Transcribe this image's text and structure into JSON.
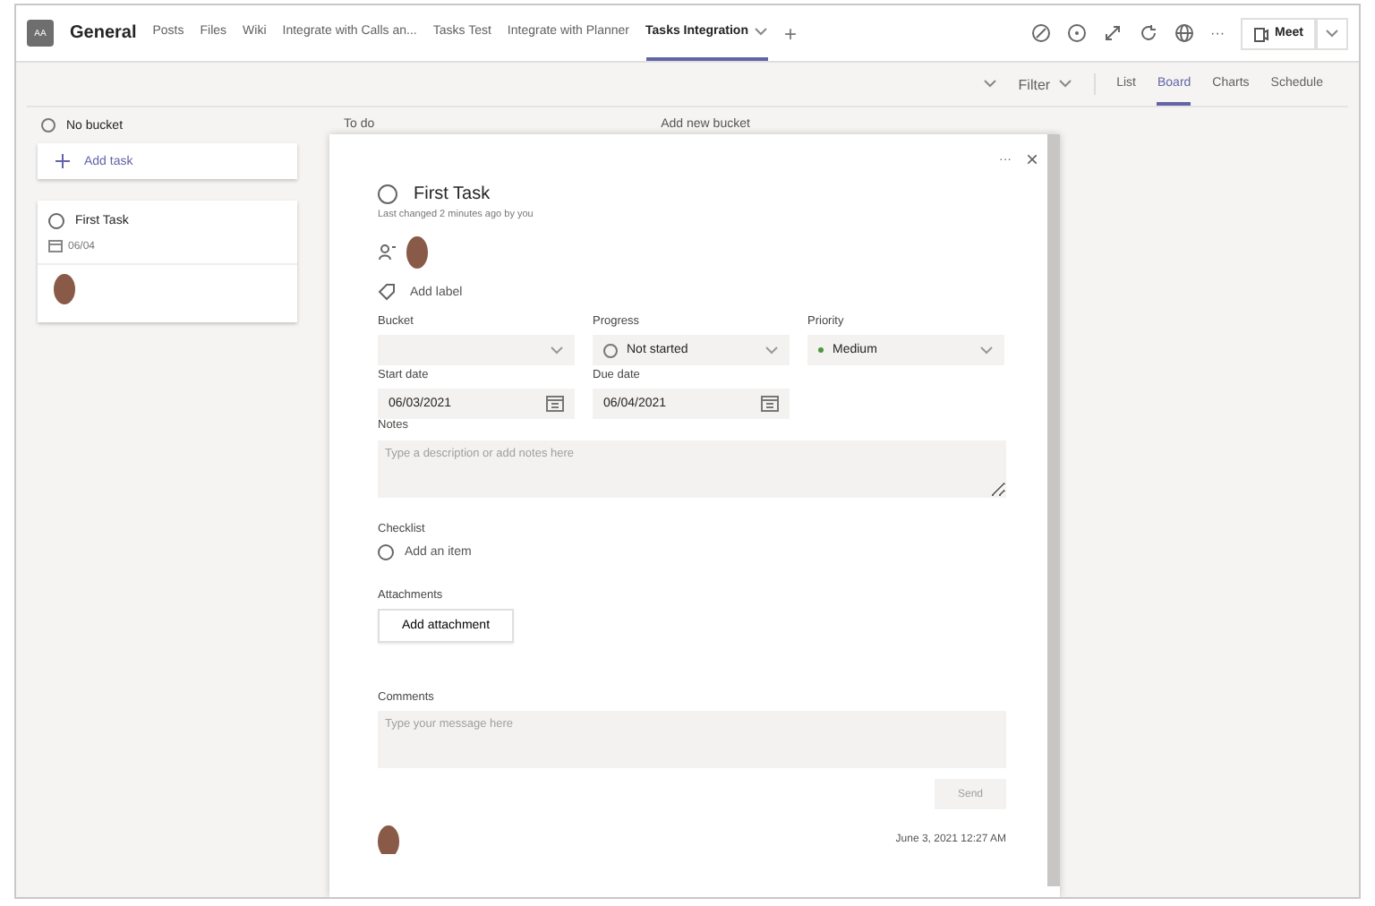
{
  "header": {
    "avatar": "AA",
    "channel": "General",
    "tabs": [
      {
        "label": "Posts",
        "selected": false
      },
      {
        "label": "Files",
        "selected": false
      },
      {
        "label": "Wiki",
        "selected": false
      },
      {
        "label": "Integrate with Calls an...",
        "selected": false
      },
      {
        "label": "Tasks Test",
        "selected": false
      },
      {
        "label": "Integrate with Planner",
        "selected": false
      },
      {
        "label": "Tasks Integration",
        "selected": true
      }
    ],
    "add_tab": "+",
    "more": "···",
    "meet_button": "Meet"
  },
  "toolbar": {
    "filter": "Filter",
    "views": [
      {
        "label": "List",
        "selected": false
      },
      {
        "label": "Board",
        "selected": true
      },
      {
        "label": "Charts",
        "selected": false
      },
      {
        "label": "Schedule",
        "selected": false
      }
    ]
  },
  "board": {
    "bucket": "No bucket",
    "add_task": "Add task",
    "card": {
      "title": "First Task",
      "completed": false,
      "due": "06/04"
    },
    "column_2": "To do",
    "column_3": "Add new bucket"
  },
  "dialog": {
    "more": "···",
    "close": "×",
    "title": "First Task",
    "completed": false,
    "last_changed": "Last changed 2 minutes ago by you",
    "add_label": "Add label",
    "fields": [
      {
        "kind": "select",
        "label": "Bucket"
      },
      {
        "kind": "progress",
        "label": "Progress",
        "value": "Not started"
      },
      {
        "kind": "priority",
        "label": "Priority",
        "value": "Medium",
        "color": "#4a9a3a"
      },
      {
        "kind": "date",
        "label": "Start date",
        "value": "06/03/2021"
      },
      {
        "kind": "date",
        "label": "Due date",
        "value": "06/04/2021"
      }
    ],
    "notes_label": "Notes",
    "notes_placeholder": "Type a description or add notes here",
    "checklist_label": "Checklist",
    "checklist_add": "Add an item",
    "checklist_checked": false,
    "attachments_label": "Attachments",
    "add_attachment": "Add attachment",
    "comments_label": "Comments",
    "comments_placeholder": "Type your message here",
    "send": "Send",
    "comment_time": "June 3, 2021 12:27 AM"
  }
}
